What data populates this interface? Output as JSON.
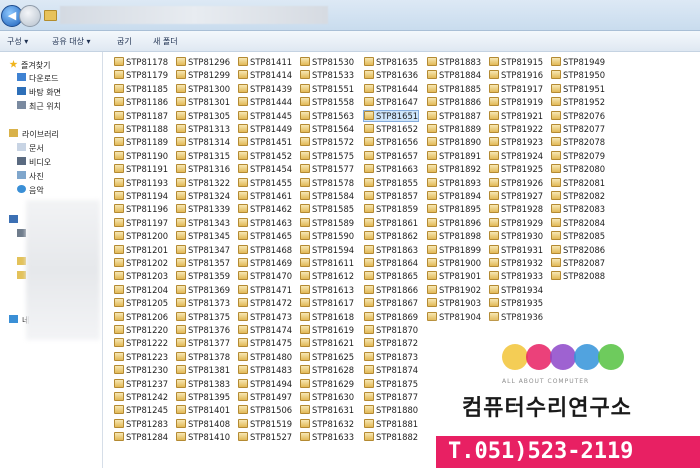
{
  "toolbar": {
    "organize": "구성 ▾",
    "share": "공유 대상 ▾",
    "burn": "굽기",
    "new_folder": "새 폴더"
  },
  "nav": {
    "favorites": "즐겨찾기",
    "fav_items": [
      "다운로드",
      "바탕 화면",
      "최근 위치"
    ],
    "libraries": "라이브러리",
    "lib_items": [
      "문서",
      "비디오",
      "사진",
      "음악"
    ],
    "network": "네"
  },
  "files": [
    [
      "STP81178",
      "STP81179",
      "STP81185",
      "STP81186",
      "STP81187",
      "STP81188",
      "STP81189",
      "STP81190",
      "STP81191",
      "STP81193",
      "STP81194",
      "STP81196",
      "STP81197",
      "STP81200",
      "STP81201",
      "STP81202",
      "STP81203",
      "STP81204",
      "STP81205",
      "STP81206",
      "STP81220",
      "STP81222",
      "STP81223",
      "STP81230",
      "STP81237",
      "STP81242",
      "STP81245",
      "STP81283",
      "STP81284"
    ],
    [
      "STP81296",
      "STP81299",
      "STP81300",
      "STP81301",
      "STP81305",
      "STP81313",
      "STP81314",
      "STP81315",
      "STP81316",
      "STP81322",
      "STP81324",
      "STP81339",
      "STP81343",
      "STP81345",
      "STP81347",
      "STP81357",
      "STP81359",
      "STP81369",
      "STP81373",
      "STP81375",
      "STP81376",
      "STP81377",
      "STP81378",
      "STP81381",
      "STP81383",
      "STP81395",
      "STP81401",
      "STP81408",
      "STP81410"
    ],
    [
      "STP81411",
      "STP81414",
      "STP81439",
      "STP81444",
      "STP81445",
      "STP81449",
      "STP81451",
      "STP81452",
      "STP81454",
      "STP81455",
      "STP81461",
      "STP81462",
      "STP81463",
      "STP81465",
      "STP81468",
      "STP81469",
      "STP81470",
      "STP81471",
      "STP81472",
      "STP81473",
      "STP81474",
      "STP81475",
      "STP81480",
      "STP81483",
      "STP81494",
      "STP81497",
      "STP81506",
      "STP81519",
      "STP81527"
    ],
    [
      "STP81530",
      "STP81533",
      "STP81551",
      "STP81558",
      "STP81563",
      "STP81564",
      "STP81572",
      "STP81575",
      "STP81577",
      "STP81578",
      "STP81584",
      "STP81585",
      "STP81589",
      "STP81590",
      "STP81594",
      "STP81611",
      "STP81612",
      "STP81613",
      "STP81617",
      "STP81618",
      "STP81619",
      "STP81621",
      "STP81625",
      "STP81628",
      "STP81629",
      "STP81630",
      "STP81631",
      "STP81632",
      "STP81633"
    ],
    [
      "STP81635",
      "STP81636",
      "STP81644",
      "STP81647",
      "STP81651",
      "STP81652",
      "STP81656",
      "STP81657",
      "STP81663",
      "STP81855",
      "STP81857",
      "STP81859",
      "STP81861",
      "STP81862",
      "STP81863",
      "STP81864",
      "STP81865",
      "STP81866",
      "STP81867",
      "STP81869",
      "STP81870",
      "STP81872",
      "STP81873",
      "STP81874",
      "STP81875",
      "STP81877",
      "STP81880",
      "STP81881",
      "STP81882"
    ],
    [
      "STP81883",
      "STP81884",
      "STP81885",
      "STP81886",
      "STP81887",
      "STP81889",
      "STP81890",
      "STP81891",
      "STP81892",
      "STP81893",
      "STP81894",
      "STP81895",
      "STP81896",
      "STP81898",
      "STP81899",
      "STP81900",
      "STP81901",
      "STP81902",
      "STP81903",
      "STP81904"
    ],
    [
      "STP81915",
      "STP81916",
      "STP81917",
      "STP81919",
      "STP81921",
      "STP81922",
      "STP81923",
      "STP81924",
      "STP81925",
      "STP81926",
      "STP81927",
      "STP81928",
      "STP81929",
      "STP81930",
      "STP81931",
      "STP81932",
      "STP81933",
      "STP81934",
      "STP81935",
      "STP81936"
    ],
    [
      "STP81949",
      "STP81950",
      "STP81951",
      "STP81952",
      "STP82076",
      "STP82077",
      "STP82078",
      "STP82079",
      "STP82080",
      "STP82081",
      "STP82082",
      "STP82083",
      "STP82084",
      "STP82085",
      "STP82086",
      "STP82087",
      "STP82088"
    ]
  ],
  "ad": {
    "tagline": "ALL ABOUT COMPUTER",
    "title": "컴퓨터수리연구소",
    "phone": "T.051)523-2119",
    "circle_colors": [
      "#f2c230",
      "#e8175d",
      "#8a3fc8",
      "#2a8fd8",
      "#4fbf3a"
    ]
  },
  "colors": {
    "selection": "#cfe6fb",
    "accent": "#1d5fb8"
  }
}
